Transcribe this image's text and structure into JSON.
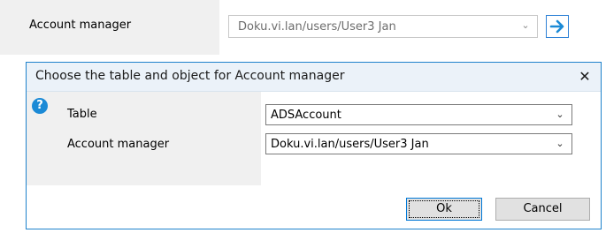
{
  "background": {
    "field_label": "Account manager",
    "field_value": "Doku.vi.lan/users/User3 Jan",
    "go_icon": "arrow-right-icon"
  },
  "dialog": {
    "title": "Choose the table and object for Account manager",
    "close_icon": "close-icon",
    "help_icon": "help-icon",
    "rows": [
      {
        "label": "Table",
        "value": "ADSAccount"
      },
      {
        "label": "Account manager",
        "value": "Doku.vi.lan/users/User3 Jan"
      }
    ],
    "ok_label": "Ok",
    "cancel_label": "Cancel"
  },
  "colors": {
    "accent": "#1e82cc",
    "title_bar": "#ebf2f9",
    "panel": "#f0f0f0"
  }
}
